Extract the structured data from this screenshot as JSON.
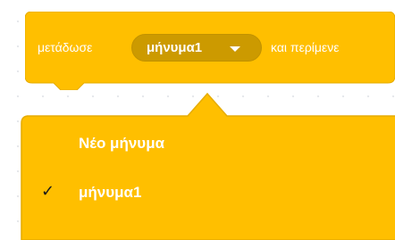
{
  "block": {
    "prefix": "μετάδωσε",
    "message_value": "μήνυμα1",
    "suffix": "και περίμενε",
    "color": "#ffbf00",
    "dropdown_color": "#cc9a00"
  },
  "menu": {
    "items": [
      {
        "label": "Νέο μήνυμα",
        "selected": false
      },
      {
        "label": "μήνυμα1",
        "selected": true,
        "icon": "check-icon"
      }
    ],
    "check_glyph": "✓",
    "background": "#ffbf00"
  }
}
